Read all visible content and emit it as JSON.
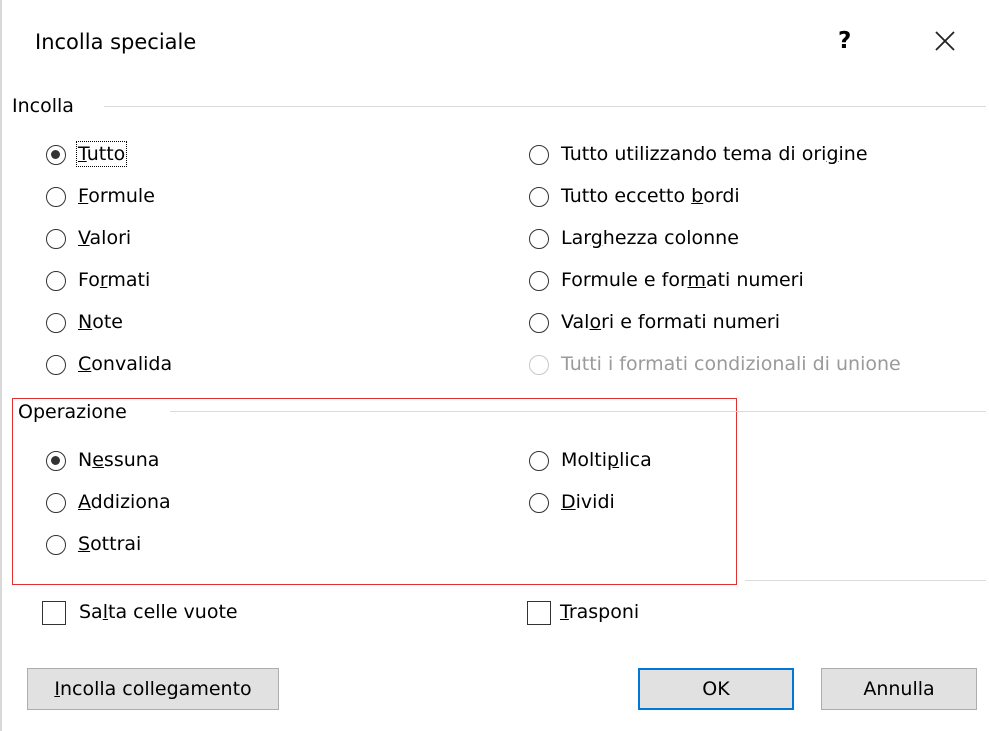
{
  "window": {
    "title": "Incolla speciale",
    "help_label": "?",
    "close_icon": "close-icon"
  },
  "paste": {
    "label": "Incolla",
    "left": [
      {
        "pre": "",
        "u": "T",
        "post": "utto",
        "checked": true,
        "disabled": false
      },
      {
        "pre": "",
        "u": "F",
        "post": "ormule",
        "checked": false,
        "disabled": false
      },
      {
        "pre": "",
        "u": "V",
        "post": "alori",
        "checked": false,
        "disabled": false
      },
      {
        "pre": "Fo",
        "u": "r",
        "post": "mati",
        "checked": false,
        "disabled": false
      },
      {
        "pre": "",
        "u": "N",
        "post": "ote",
        "checked": false,
        "disabled": false
      },
      {
        "pre": "",
        "u": "C",
        "post": "onvalida",
        "checked": false,
        "disabled": false
      }
    ],
    "right": [
      {
        "pre": "Tutto utilizzando tema di ori",
        "u": "g",
        "post": "ine",
        "checked": false,
        "disabled": false
      },
      {
        "pre": "Tutto eccetto ",
        "u": "b",
        "post": "ordi",
        "checked": false,
        "disabled": false
      },
      {
        "pre": "Lar",
        "u": "g",
        "post": "hezza colonne",
        "checked": false,
        "disabled": false
      },
      {
        "pre": "Formule e for",
        "u": "m",
        "post": "ati numeri",
        "checked": false,
        "disabled": false
      },
      {
        "pre": "Val",
        "u": "o",
        "post": "ri e formati numeri",
        "checked": false,
        "disabled": false
      },
      {
        "pre": "Tutti i formati condizionali di unione",
        "u": "",
        "post": "",
        "checked": false,
        "disabled": true
      }
    ]
  },
  "operation": {
    "label": "Operazione",
    "left": [
      {
        "pre": "N",
        "u": "e",
        "post": "ssuna",
        "checked": true
      },
      {
        "pre": "",
        "u": "A",
        "post": "ddiziona",
        "checked": false
      },
      {
        "pre": "",
        "u": "S",
        "post": "ottrai",
        "checked": false
      }
    ],
    "right": [
      {
        "pre": "Molti",
        "u": "p",
        "post": "lica",
        "checked": false
      },
      {
        "pre": "",
        "u": "D",
        "post": "ividi",
        "checked": false
      }
    ]
  },
  "options": {
    "skip_blanks": {
      "pre": "Sa",
      "u": "l",
      "post": "ta celle vuote",
      "checked": false
    },
    "transpose": {
      "pre": "",
      "u": "T",
      "post": "rasponi",
      "checked": false
    }
  },
  "buttons": {
    "paste_link": {
      "pre": "",
      "u": "I",
      "post": "ncolla collegamento"
    },
    "ok": "OK",
    "cancel": "Annulla"
  },
  "colors": {
    "highlight_border": "#e03030",
    "default_button_border": "#0078d7"
  }
}
